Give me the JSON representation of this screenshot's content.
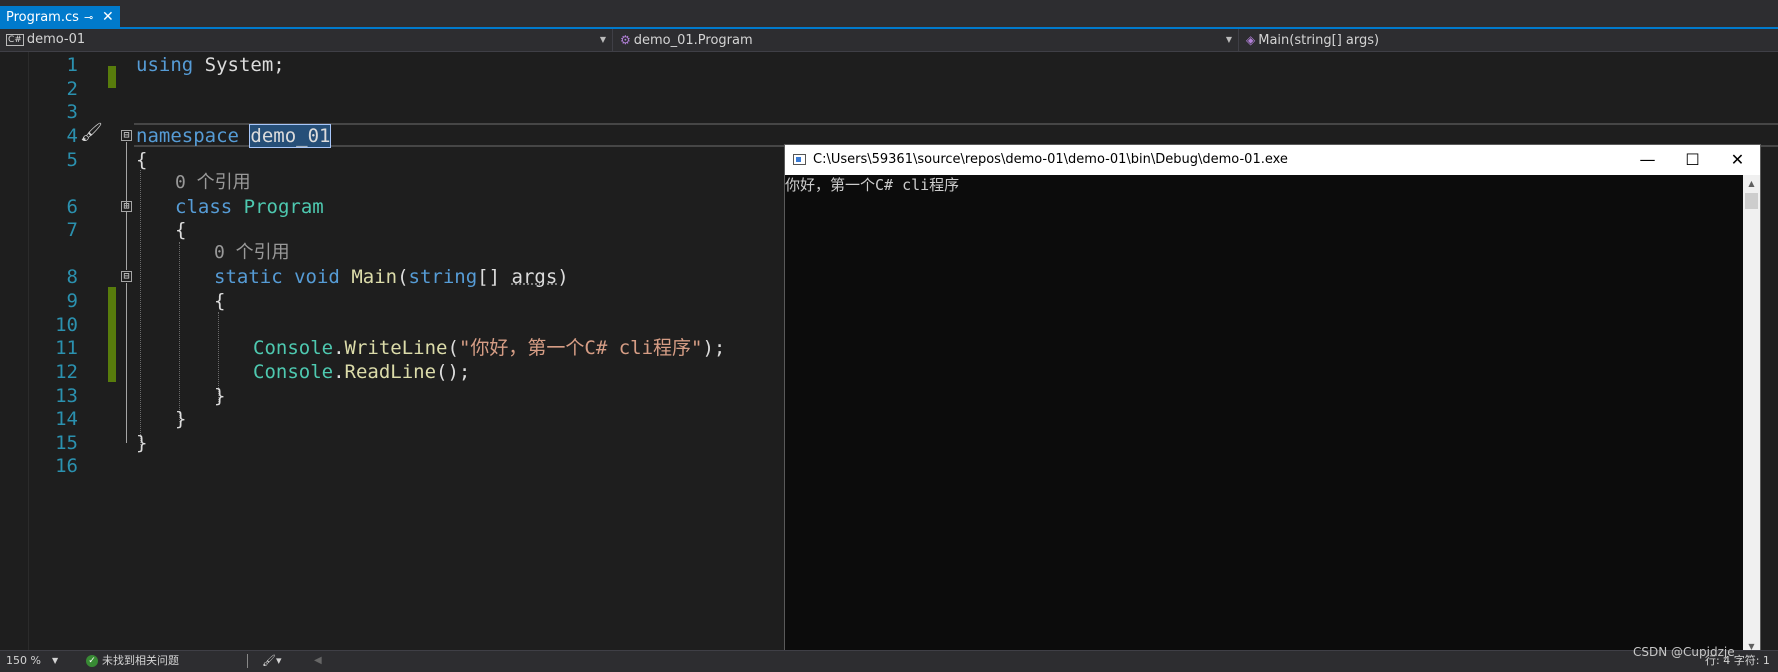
{
  "tab": {
    "label": "Program.cs",
    "pin_icon": "⊸",
    "close_icon": "✕"
  },
  "navbar": {
    "project": "demo-01",
    "project_icon": "C#",
    "type": "demo_01.Program",
    "member": "Main(string[] args)"
  },
  "editor": {
    "line_numbers": [
      "1",
      "2",
      "3",
      "4",
      "5",
      "6",
      "7",
      "8",
      "9",
      "10",
      "11",
      "12",
      "13",
      "14",
      "15",
      "16"
    ],
    "ref_count_label": "0 个引用",
    "code": {
      "l1_kw": "using",
      "l1_rest": " System;",
      "l4_kw": "namespace",
      "l4_name": "demo_01",
      "l5": "{",
      "l6_kw": "class",
      "l6_type": "Program",
      "l7": "{",
      "l8_kw1": "static",
      "l8_kw2": "void",
      "l8_fn": "Main",
      "l8_p1": "(",
      "l8_kw3": "string",
      "l8_p2": "[] ",
      "l8_arg": "args",
      "l8_p3": ")",
      "l9": "{",
      "l11_type": "Console",
      "l11_dot": ".",
      "l11_fn": "WriteLine",
      "l11_p1": "(",
      "l11_str": "\"你好，第一个C# cli程序\"",
      "l11_p2": ");",
      "l12_type": "Console",
      "l12_dot": ".",
      "l12_fn": "ReadLine",
      "l12_p": "();",
      "l13": "}",
      "l14": "}",
      "l15": "}"
    },
    "fold_symbol": "⊟"
  },
  "console": {
    "title": "C:\\Users\\59361\\source\\repos\\demo-01\\demo-01\\bin\\Debug\\demo-01.exe",
    "output": "你好，第一个C# cli程序",
    "minimize": "—",
    "maximize": "☐",
    "close": "✕"
  },
  "statusbar": {
    "zoom": "150 %",
    "issues": "未找到相关问题",
    "position": "行: 4    字符: 1"
  },
  "watermark": "CSDN @Cupidzje"
}
